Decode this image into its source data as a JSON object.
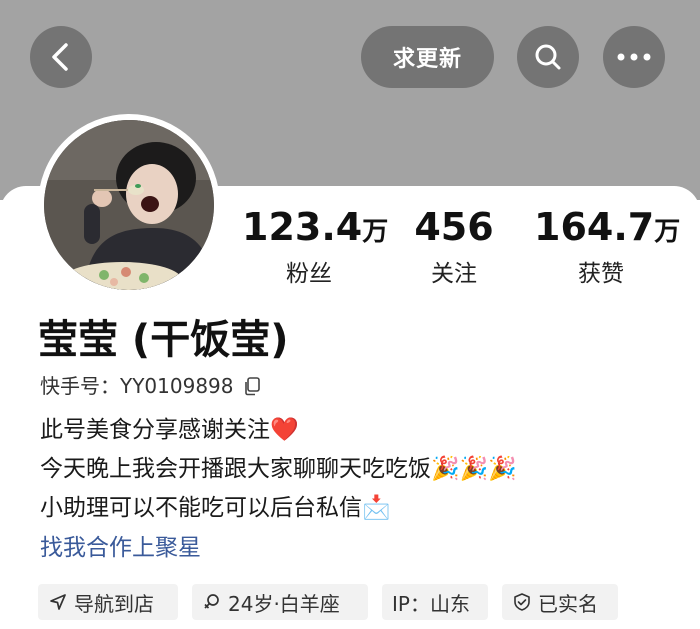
{
  "header": {
    "follow_request_label": "求更新",
    "accent_bg": "#a3a3a3"
  },
  "icons": {
    "back": "chevron-left-icon",
    "search": "search-icon",
    "more": "more-dots-icon",
    "copy": "copy-icon",
    "location": "navigation-arrow-icon",
    "gender": "female-icon",
    "verified": "shield-check-icon"
  },
  "stats": [
    {
      "number": "123.4",
      "unit": "万",
      "label": "粉丝"
    },
    {
      "number": "456",
      "unit": "",
      "label": "关注"
    },
    {
      "number": "164.7",
      "unit": "万",
      "label": "获赞"
    }
  ],
  "profile": {
    "name": "莹莹 (干饭莹)",
    "id_line": "快手号：YY0109898",
    "bio": [
      "此号美食分享感谢关注❤️",
      "今天晚上我会开播跟大家聊聊天吃吃饭🎉🎉🎉",
      "小助理可以不能吃可以后台私信📩"
    ],
    "link_text": "找我合作上聚星",
    "link_color": "#3a5a9a"
  },
  "tags": [
    {
      "label": "导航到店"
    },
    {
      "label": "24岁·白羊座"
    },
    {
      "label": "IP：山东"
    },
    {
      "label": "已实名"
    }
  ]
}
